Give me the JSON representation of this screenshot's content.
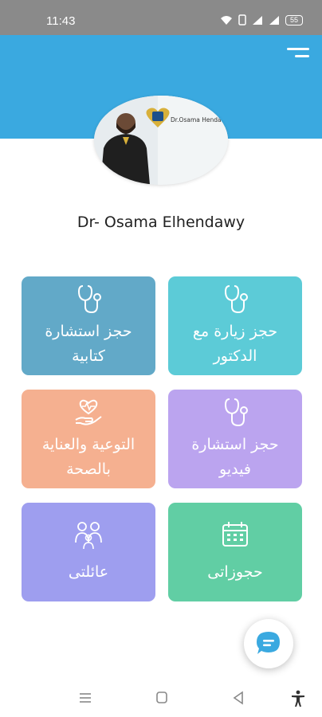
{
  "status_bar": {
    "time": "11:43",
    "battery": "55"
  },
  "header": {
    "menu_icon": "hamburger-menu-icon",
    "color": "#3aa9e0"
  },
  "profile": {
    "name": "Dr- Osama Elhendawy",
    "photo_sign": "Dr.Osama Hendawy"
  },
  "tiles": [
    {
      "id": "visit",
      "label_lines": [
        "حجز زيارة مع",
        "الدكتور"
      ],
      "icon": "stethoscope-icon",
      "color": "#5ccbd7"
    },
    {
      "id": "written",
      "label_lines": [
        "حجز استشارة",
        "كتابية"
      ],
      "icon": "stethoscope-icon",
      "color": "#62a9c8"
    },
    {
      "id": "video",
      "label_lines": [
        "حجز استشارة",
        "فيديو"
      ],
      "icon": "stethoscope-icon",
      "color": "#bba4ef"
    },
    {
      "id": "awareness",
      "label_lines": [
        "التوعية والعناية",
        "بالصحة"
      ],
      "icon": "health-care-icon",
      "color": "#f5b090"
    },
    {
      "id": "bookings",
      "label_lines": [
        "حجوزاتى"
      ],
      "icon": "calendar-icon",
      "color": "#61cea4"
    },
    {
      "id": "family",
      "label_lines": [
        "عائلتى"
      ],
      "icon": "family-icon",
      "color": "#9e9eef"
    }
  ],
  "chat_button": {
    "icon": "chat-icon",
    "color": "#3aa9e0"
  },
  "nav_bar": {
    "icons": [
      "recent-apps-icon",
      "home-icon",
      "back-icon",
      "accessibility-icon"
    ]
  }
}
